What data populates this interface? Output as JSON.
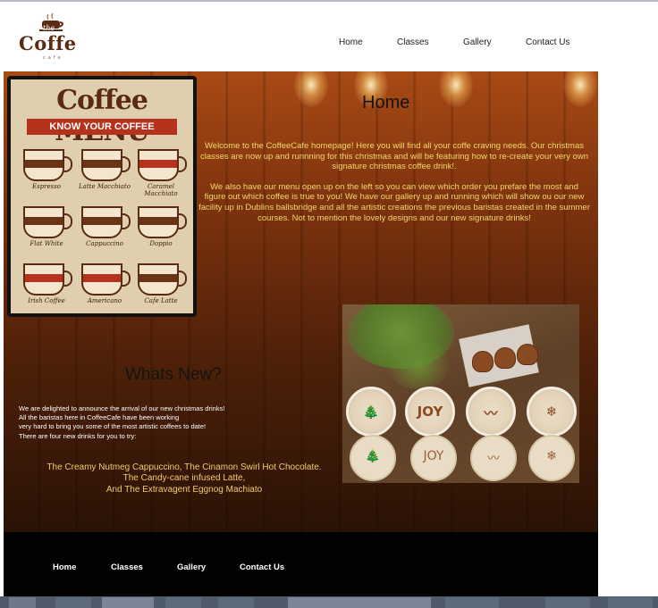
{
  "brand": {
    "script": "the",
    "name": "Coffe",
    "sub": "cafe"
  },
  "nav": [
    "Home",
    "Classes",
    "Gallery",
    "Contact Us"
  ],
  "home": {
    "heading": "Home",
    "intro": [
      "Welcome to the CoffeeCafe homepage! Here you will find all your coffe craving needs. Our christmas classes are now up and runnning for this christmas and will be featuring how to re-create your very own signature christmas coffee drink!.",
      "We also have our menu open up on the left so you can view which order you prefare the most and figure out which coffee is true to you! We have our gallery up and running which will show ou our new facility up in Dublins ballsbridge and all the artistic creations the previous baristas created in the summer courses. Not to mention the lovely designs and our new signature drinks!"
    ]
  },
  "menu_poster": {
    "title": "Coffee MENU",
    "banner": "KNOW YOUR COFFEE",
    "items": [
      {
        "label": "Espresso",
        "band": "ESPRESSO"
      },
      {
        "label": "Latte Macchiato",
        "band": "MILK"
      },
      {
        "label": "Caramel Macchiato",
        "band": "MILK"
      },
      {
        "label": "Flat White",
        "band": "MILK"
      },
      {
        "label": "Cappuccino",
        "band": "MILK"
      },
      {
        "label": "Doppio",
        "band": "ESPRESSO"
      },
      {
        "label": "Irish Coffee",
        "band": "WHISKEY"
      },
      {
        "label": "Americano",
        "band": "WATER"
      },
      {
        "label": "Cafe Latte",
        "band": "MILK"
      }
    ]
  },
  "whats_new": {
    "heading": "Whats New?",
    "announce": [
      "We are delighted to announce the arrival of our new christmas drinks!",
      "All the baristas here in CoffeeCafe have been working",
      "very hard to bring you some of the most artistic coffees to date!",
      "There are four new drinks for you to try:"
    ],
    "drinks": [
      "The Creamy Nutmeg Cappuccino, The Cinamon Swirl Hot Chocolate.",
      "The Candy-cane infused Latte,",
      "And The Extravagent Eggnog Machiato"
    ]
  },
  "photo": {
    "top_marks": [
      "🎄",
      "JOY",
      "〰",
      "❄"
    ],
    "bottom_marks": [
      "🎄",
      "JOY",
      "〰",
      "❄"
    ]
  },
  "footer_nav": [
    "Home",
    "Classes",
    "Gallery",
    "Contact Us"
  ],
  "colors": {
    "wood": "#7c320e",
    "intro_text": "#f4d86a",
    "drinks_text": "#f0cd6c",
    "footer": "#020202"
  }
}
